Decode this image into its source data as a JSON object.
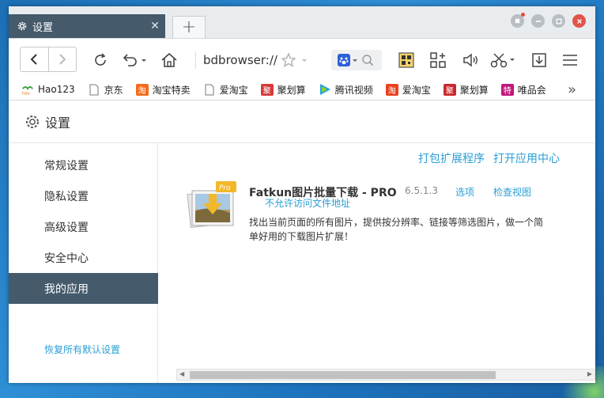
{
  "tab": {
    "title": "设置",
    "close": "✕",
    "new_tab": "+"
  },
  "window_controls": [
    "skin",
    "minimize",
    "maximize",
    "close"
  ],
  "toolbar": {
    "address": "bdbrowser://",
    "icons": [
      "back-icon",
      "forward-icon",
      "refresh-icon",
      "undo-icon",
      "home-icon",
      "star-icon",
      "paw-search-icon",
      "magnifier-icon",
      "qr-icon",
      "apps-icon",
      "volume-icon",
      "scissors-icon",
      "download-icon",
      "menu-icon"
    ]
  },
  "bookmarks": [
    {
      "label": "Hao123",
      "icon": "hao-icon",
      "color": "#3aa23a"
    },
    {
      "label": "京东",
      "icon": "page-icon",
      "color": "#888888"
    },
    {
      "label": "淘宝特卖",
      "icon": "taobao-icon",
      "color": "#f26b1d"
    },
    {
      "label": "爱淘宝",
      "icon": "page-icon",
      "color": "#888888"
    },
    {
      "label": "聚划算",
      "icon": "juhuasuan-icon",
      "color": "#d83a3a"
    },
    {
      "label": "腾讯视频",
      "icon": "tencent-video-icon",
      "color": "#20a0e0"
    },
    {
      "label": "爱淘宝",
      "icon": "taobao-icon",
      "color": "#e8411e"
    },
    {
      "label": "聚划算",
      "icon": "juhuasuan-icon",
      "color": "#c9282d"
    },
    {
      "label": "唯品会",
      "icon": "vip-icon",
      "color": "#c0197c"
    }
  ],
  "bookmarks_more": "»",
  "header": {
    "title": "设置"
  },
  "sidebar": {
    "items": [
      {
        "label": "常规设置",
        "active": false
      },
      {
        "label": "隐私设置",
        "active": false
      },
      {
        "label": "高级设置",
        "active": false
      },
      {
        "label": "安全中心",
        "active": false
      },
      {
        "label": "我的应用",
        "active": true
      }
    ],
    "reset": "恢复所有默认设置"
  },
  "main": {
    "pack_link": "打包扩展程序",
    "app_center_link": "打开应用中心",
    "extension": {
      "name": "Fatkun图片批量下载 - PRO",
      "version": "6.5.1.3",
      "options": "选项",
      "inspect": "检查视图",
      "no_file_access": "不允许访问文件地址",
      "description": "找出当前页面的所有图片，提供按分辨率、链接等筛选图片，做一个简单好用的下载图片扩展！",
      "badge": "Pro"
    }
  },
  "colors": {
    "accent": "#2a9fd6",
    "active_bg": "#455a6b",
    "close_red": "#e1544b"
  }
}
